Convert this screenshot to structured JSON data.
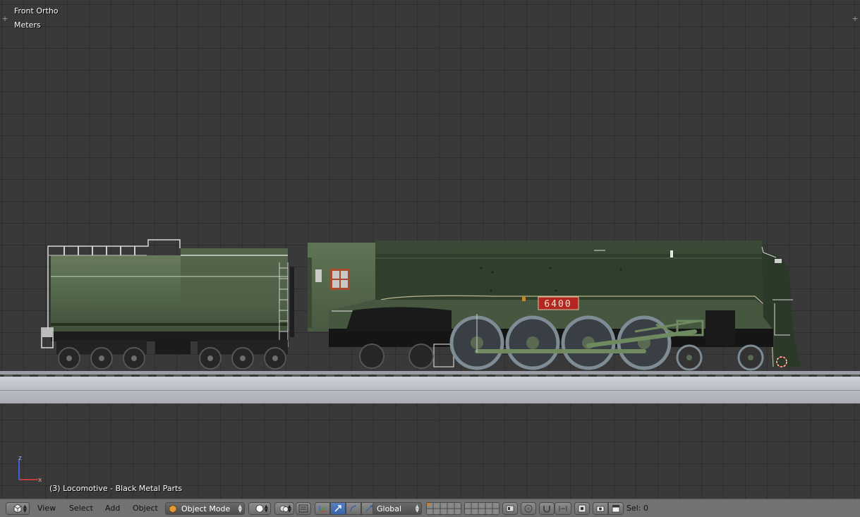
{
  "viewport": {
    "view_name": "Front Ortho",
    "units": "Meters",
    "selected_object": "(3) Locomotive - Black Metal Parts",
    "locomotive_number": "6400",
    "axis_gizmo": {
      "x_label": "x",
      "z_label": "z",
      "x_color": "#c04040",
      "z_color": "#4060d0"
    }
  },
  "header": {
    "menus": {
      "view": "View",
      "select": "Select",
      "add": "Add",
      "object": "Object"
    },
    "mode": "Object Mode",
    "orientation": "Global",
    "status": "Sel: 0"
  },
  "colors": {
    "background": "#393939",
    "loco_green": "#4e6347",
    "header_bg": "#727272",
    "number_plate": "#b2271f"
  }
}
